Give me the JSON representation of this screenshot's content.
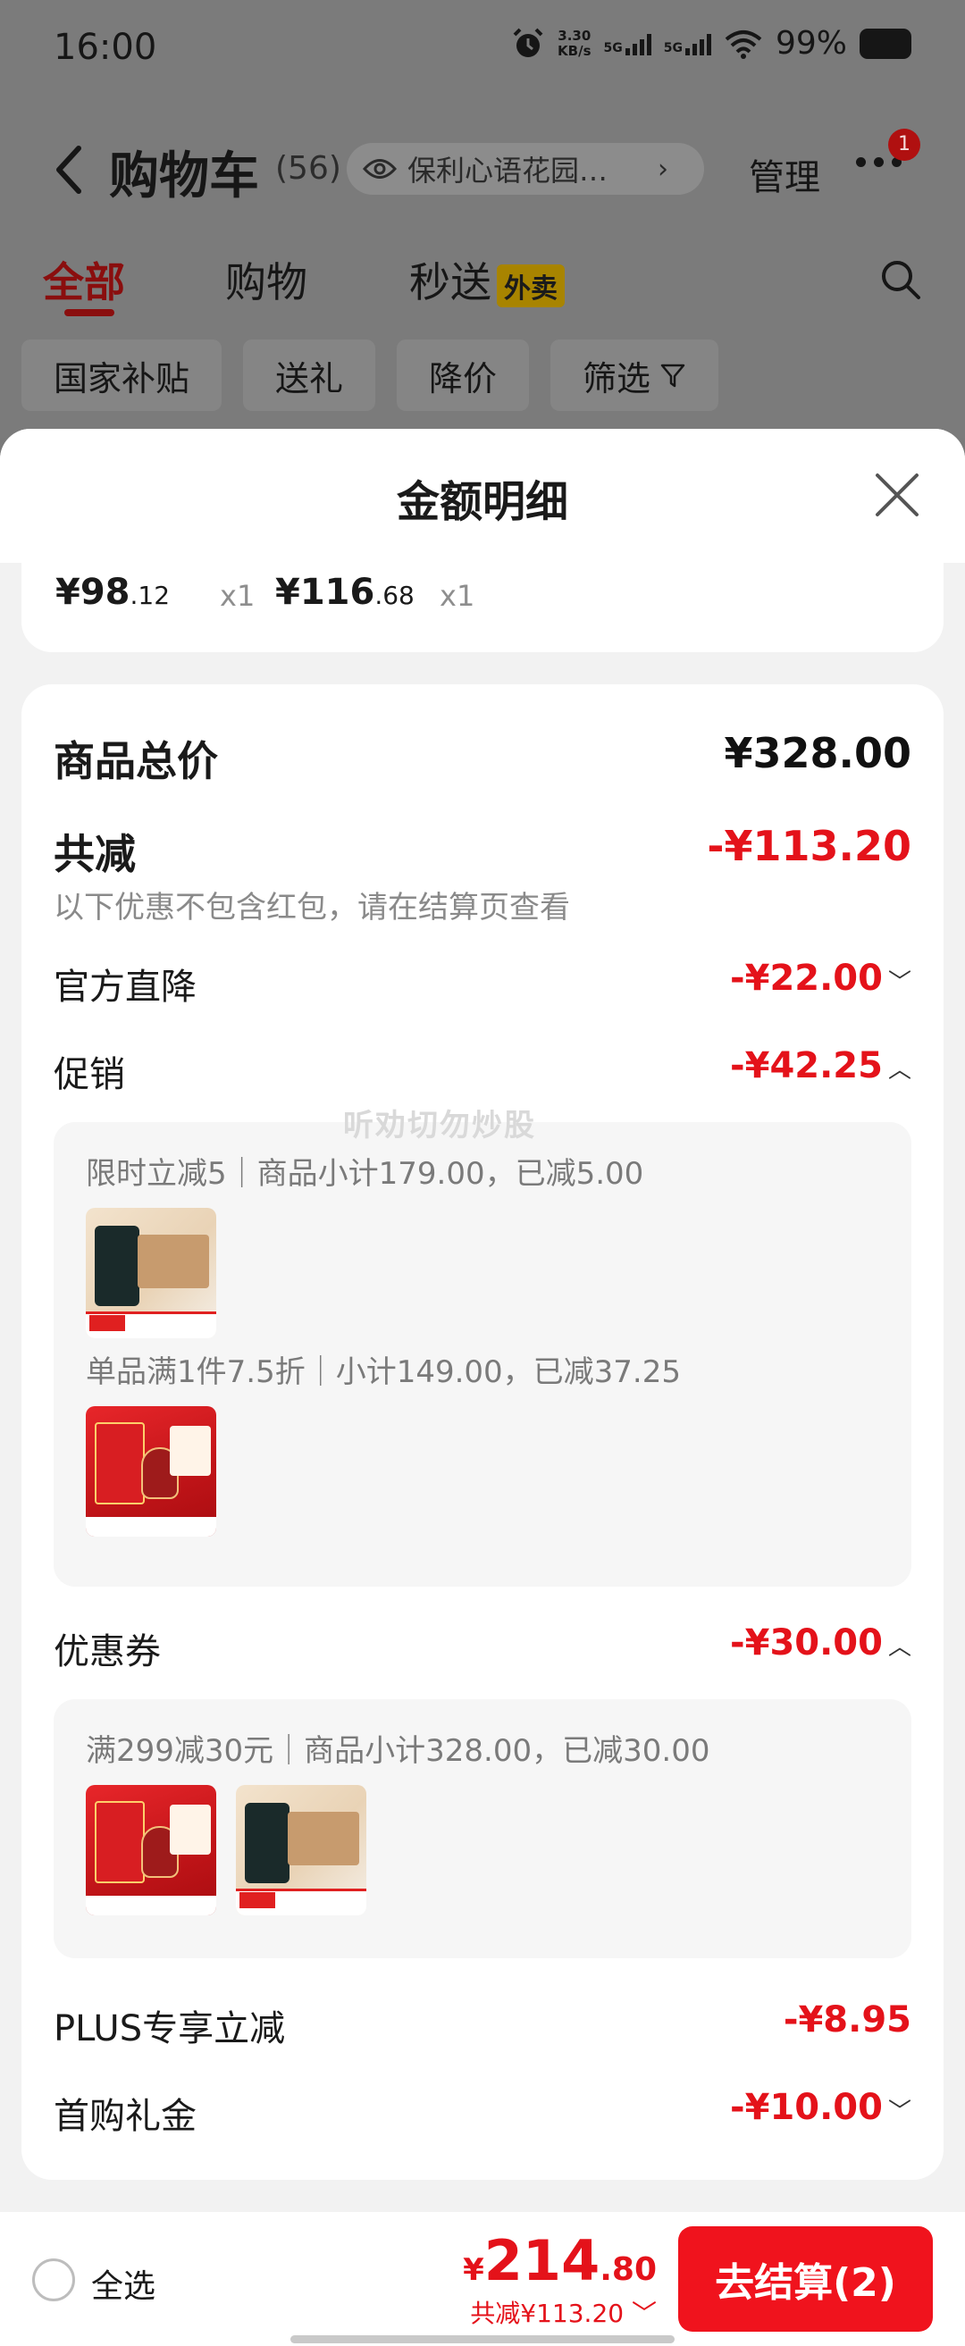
{
  "status_bar": {
    "time": "16:00",
    "net_speed_value": "3.30",
    "net_speed_unit": "KB/s",
    "sig1": "5G",
    "sig2": "5G",
    "battery": "99%"
  },
  "nav": {
    "title": "购物车",
    "count": "(56)",
    "address": "保利心语花园…",
    "manage": "管理",
    "badge": "1"
  },
  "tabs": [
    {
      "label": "全部",
      "active": true
    },
    {
      "label": "购物"
    },
    {
      "label": "秒送",
      "tag": "外卖"
    }
  ],
  "chips": [
    "国家补贴",
    "送礼",
    "降价",
    "筛选"
  ],
  "sheet": {
    "title": "金额明细",
    "items": [
      {
        "price_int": "¥98",
        "price_dec": ".12",
        "qty": "x1"
      },
      {
        "price_int": "¥116",
        "price_dec": ".68",
        "qty": "x1"
      }
    ],
    "total_label": "商品总价",
    "total_value": "¥328.00",
    "reduce_label": "共减",
    "reduce_value": "-¥113.20",
    "reduce_note": "以下优惠不包含红包，请在结算页查看",
    "official_label": "官方直降",
    "official_value": "-¥22.00",
    "promo_label": "促销",
    "promo_value": "-¥42.25",
    "promo_lines": [
      "限时立减5｜商品小计179.00，已减5.00",
      "单品满1件7.5折｜小计149.00，已减37.25"
    ],
    "coupon_label": "优惠券",
    "coupon_value": "-¥30.00",
    "coupon_line": "满299减30元｜商品小计328.00，已减30.00",
    "plus_label": "PLUS专享立减",
    "plus_value": "-¥8.95",
    "gift_label": "首购礼金",
    "gift_value": "-¥10.00",
    "watermark": "听劝切勿炒股"
  },
  "bottom": {
    "select_all": "全选",
    "total_yen": "¥",
    "total_int": "214",
    "total_dec": ".80",
    "saved": "共减¥113.20",
    "checkout": "去结算(2)"
  },
  "colors": {
    "accent": "#e4121a",
    "checkout": "#f0131d"
  }
}
